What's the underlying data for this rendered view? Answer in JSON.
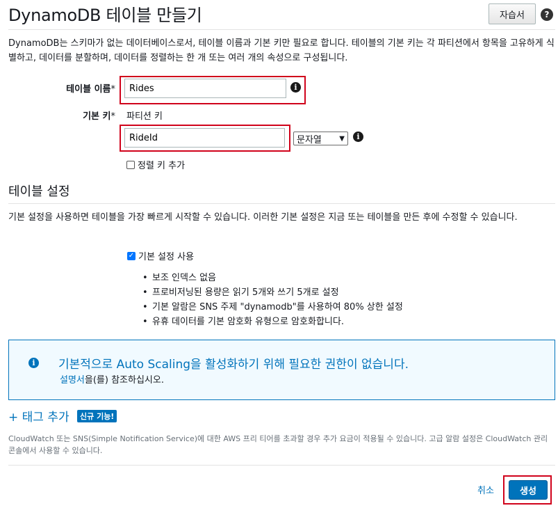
{
  "header": {
    "title": "DynamoDB 테이블 만들기",
    "tutorial_label": "자습서",
    "help_icon": "help-icon"
  },
  "intro": {
    "text": "DynamoDB는 스키마가 없는 데이터베이스로서, 테이블 이름과 기본 키만 필요로 합니다. 테이블의 기본 키는 각 파티션에서 항목을 고유하게 식별하고, 데이터를 분할하며, 데이터를 정렬하는 한 개 또는 여러 개의 속성으로 구성됩니다."
  },
  "form": {
    "table_name_label": "테이블 이름",
    "table_name_value": "Rides",
    "required_mark": "*",
    "primary_key_label": "기본 키",
    "partition_key_label": "파티션 키",
    "partition_key_value": "RideId",
    "key_type_selected": "문자열",
    "add_sort_key_label": "정렬 키 추가",
    "add_sort_key_checked": false
  },
  "table_settings": {
    "title": "테이블 설정",
    "description": "기본 설정을 사용하면 테이블을 가장 빠르게 시작할 수 있습니다. 이러한 기본 설정은 지금 또는 테이블을 만든 후에 수정할 수 있습니다.",
    "use_defaults_label": "기본 설정 사용",
    "use_defaults_checked": true,
    "defaults": [
      "보조 인덱스 없음",
      "프로비저닝된 용량은 읽기 5개와 쓰기 5개로 설정",
      "기본 알람은 SNS 주제 \"dynamodb\"를 사용하여 80% 상한 설정",
      "유휴 데이터를 기본 암호화 유형으로 암호화합니다."
    ]
  },
  "info_panel": {
    "title": "기본적으로 Auto Scaling을 활성화하기 위해 필요한 권한이 없습니다.",
    "link_text": "설명서",
    "link_suffix": "을(를) 참조하십시오."
  },
  "tags": {
    "add_label": "+ 태그 추가",
    "badge": "신규 기능!"
  },
  "footnote": "CloudWatch 또는 SNS(Simple Notification Service)에 대한 AWS 프리 티어를 초과할 경우 추가 요금이 적용될 수 있습니다. 고급 알람 설정은 CloudWatch 관리 콘솔에서 사용할 수 있습니다.",
  "actions": {
    "cancel_label": "취소",
    "create_label": "생성"
  },
  "colors": {
    "accent": "#0073bb",
    "highlight": "#d0021b"
  }
}
